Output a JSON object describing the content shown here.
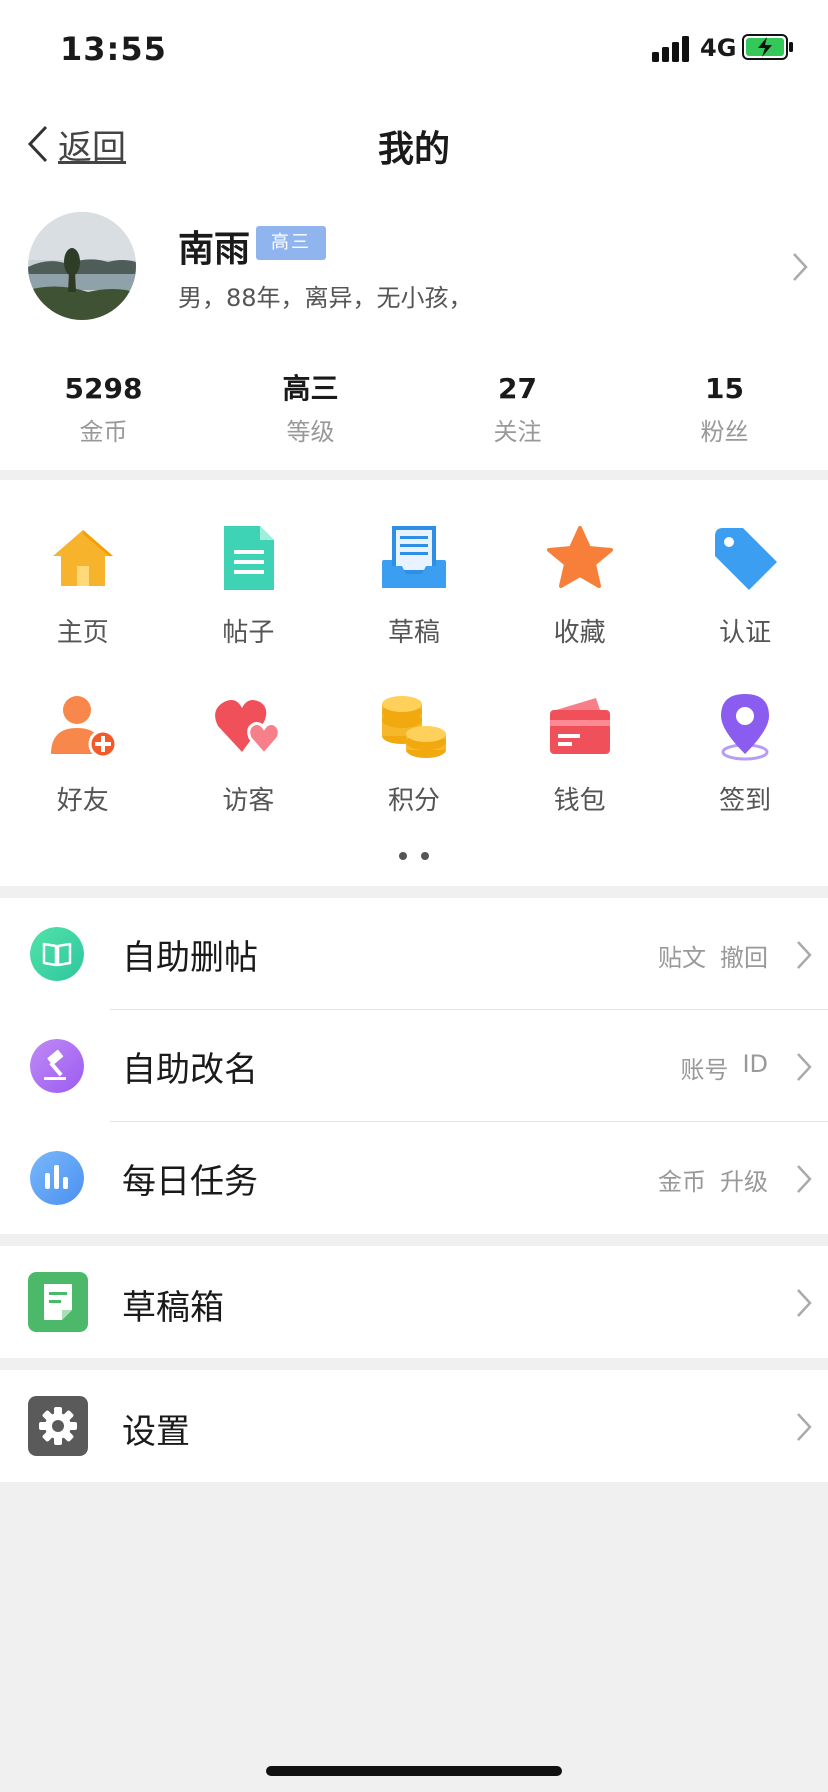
{
  "status": {
    "time": "13:55",
    "network": "4G"
  },
  "nav": {
    "back_label": "返回",
    "title": "我的"
  },
  "profile": {
    "name": "南雨",
    "badge": "高三",
    "info": "男，88年，离异，无小孩，"
  },
  "stats": [
    {
      "value": "5298",
      "label": "金币"
    },
    {
      "value": "高三",
      "label": "等级"
    },
    {
      "value": "27",
      "label": "关注"
    },
    {
      "value": "15",
      "label": "粉丝"
    }
  ],
  "grid": [
    {
      "label": "主页",
      "icon": "home-icon"
    },
    {
      "label": "帖子",
      "icon": "document-icon"
    },
    {
      "label": "草稿",
      "icon": "draft-tray-icon"
    },
    {
      "label": "收藏",
      "icon": "star-icon"
    },
    {
      "label": "认证",
      "icon": "tag-icon"
    },
    {
      "label": "好友",
      "icon": "add-friend-icon"
    },
    {
      "label": "访客",
      "icon": "hearts-icon"
    },
    {
      "label": "积分",
      "icon": "coins-icon"
    },
    {
      "label": "钱包",
      "icon": "wallet-icon"
    },
    {
      "label": "签到",
      "icon": "location-pin-icon"
    }
  ],
  "list": [
    {
      "title": "自助删帖",
      "tags": [
        "贴文",
        "撤回"
      ],
      "icon": "book-icon"
    },
    {
      "title": "自助改名",
      "tags": [
        "账号",
        "ID"
      ],
      "icon": "gavel-icon"
    },
    {
      "title": "每日任务",
      "tags": [
        "金币",
        "升级"
      ],
      "icon": "bar-chart-icon"
    }
  ],
  "drafts": {
    "title": "草稿箱",
    "icon": "notepad-icon"
  },
  "settings": {
    "title": "设置",
    "icon": "gear-icon"
  },
  "colors": {
    "badge": "#8fb4ee",
    "divider": "#e4e4e4",
    "page_bg": "#f0f0f0"
  }
}
